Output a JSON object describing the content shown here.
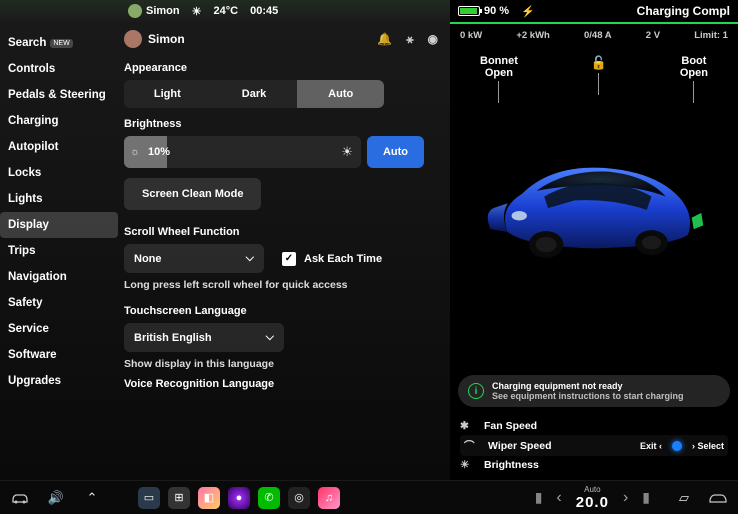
{
  "topstatus": {
    "user": "Simon",
    "temp": "24°C",
    "time": "00:45"
  },
  "sidebar": {
    "items": [
      {
        "label": "Search",
        "badge": "NEW"
      },
      {
        "label": "Controls"
      },
      {
        "label": "Pedals & Steering"
      },
      {
        "label": "Charging"
      },
      {
        "label": "Autopilot"
      },
      {
        "label": "Locks"
      },
      {
        "label": "Lights"
      },
      {
        "label": "Display"
      },
      {
        "label": "Trips"
      },
      {
        "label": "Navigation"
      },
      {
        "label": "Safety"
      },
      {
        "label": "Service"
      },
      {
        "label": "Software"
      },
      {
        "label": "Upgrades"
      }
    ],
    "active_index": 7
  },
  "settings": {
    "profile_name": "Simon",
    "appearance": {
      "label": "Appearance",
      "options": [
        "Light",
        "Dark",
        "Auto"
      ],
      "selected": "Auto"
    },
    "brightness": {
      "label": "Brightness",
      "value": "10%",
      "auto_label": "Auto"
    },
    "screen_clean": "Screen Clean Mode",
    "scroll_wheel": {
      "label": "Scroll Wheel Function",
      "value": "None",
      "ask_label": "Ask Each Time",
      "ask_checked": true,
      "hint": "Long press left scroll wheel for quick access"
    },
    "touchscreen_lang": {
      "label": "Touchscreen Language",
      "value": "British English",
      "hint": "Show display in this language"
    },
    "voice_lang_label": "Voice Recognition Language"
  },
  "charging": {
    "battery_pct": "90 %",
    "title": "Charging Compl",
    "stats": {
      "power": "0 kW",
      "added": "+2 kWh",
      "amps": "0/48 A",
      "volts": "2 V",
      "limit": "Limit: 1"
    },
    "labels": {
      "bonnet": "Bonnet\nOpen",
      "boot": "Boot\nOpen",
      "unlock": "unlocked"
    },
    "banner": {
      "title": "Charging equipment not ready",
      "subtitle": "See equipment instructions to start charging"
    }
  },
  "wheel_menu": {
    "items": [
      {
        "icon": "fan",
        "label": "Fan Speed"
      },
      {
        "icon": "wiper",
        "label": "Wiper Speed"
      },
      {
        "icon": "bright",
        "label": "Brightness"
      }
    ],
    "exit_label": "Exit",
    "select_label": "Select"
  },
  "bottombar": {
    "auto_label": "Auto",
    "temp": "20.0"
  }
}
